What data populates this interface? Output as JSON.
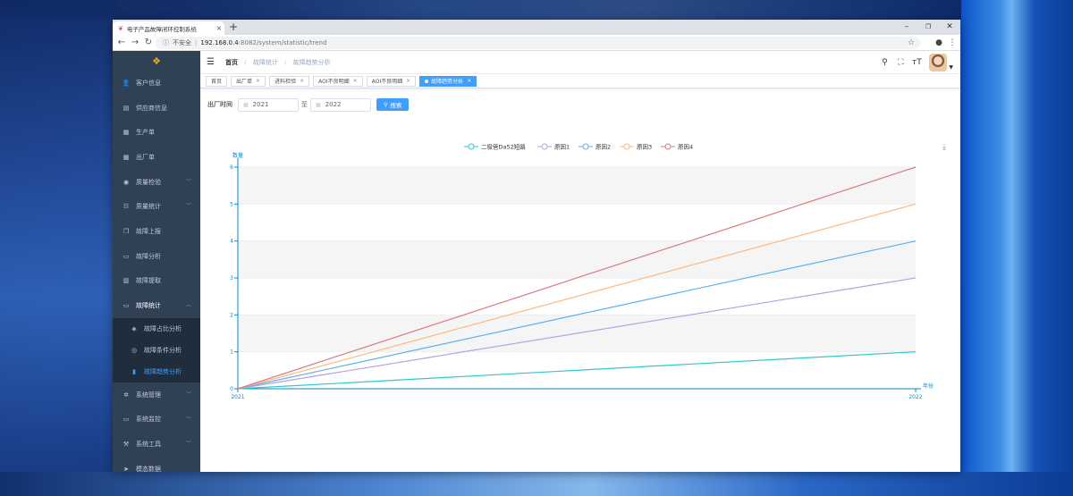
{
  "browser": {
    "tab_title": "电子产品故障闭环控制系统",
    "new_tab_symbol": "+",
    "security_label": "不安全",
    "url_host": "192.168.0.4",
    "url_path": ":8082/system/statistic/trend"
  },
  "sidebar": {
    "items": [
      {
        "label": "客户信息",
        "icon": "user-icon"
      },
      {
        "label": "供应商信息",
        "icon": "shop-icon"
      },
      {
        "label": "生产单",
        "icon": "document-icon"
      },
      {
        "label": "出厂单",
        "icon": "document-icon"
      },
      {
        "label": "质量检验",
        "icon": "eye-icon",
        "has_children": true
      },
      {
        "label": "质量统计",
        "icon": "list-icon",
        "has_children": true
      },
      {
        "label": "故障上报",
        "icon": "copy-icon"
      },
      {
        "label": "故障分析",
        "icon": "monitor-icon"
      },
      {
        "label": "故障提取",
        "icon": "table-icon"
      },
      {
        "label": "故障统计",
        "icon": "monitor-icon",
        "expanded": true
      }
    ],
    "sub_items": [
      {
        "label": "故障占比分析",
        "icon": "layers-icon"
      },
      {
        "label": "故障条件分析",
        "icon": "circle-icon"
      },
      {
        "label": "故障趋势分析",
        "icon": "bar-chart-icon",
        "current": true
      }
    ],
    "bottom_items": [
      {
        "label": "系统管理",
        "icon": "gear-icon",
        "has_children": true
      },
      {
        "label": "系统监控",
        "icon": "monitor-icon",
        "has_children": true
      },
      {
        "label": "系统工具",
        "icon": "tool-icon",
        "has_children": true
      },
      {
        "label": "模态数据",
        "icon": "send-icon"
      }
    ]
  },
  "breadcrumb": [
    "首页",
    "故障统计",
    "故障趋势分析"
  ],
  "tags": [
    {
      "label": "首页",
      "closable": false
    },
    {
      "label": "出厂单",
      "closable": true
    },
    {
      "label": "进料检验",
      "closable": true
    },
    {
      "label": "AOI不良明细",
      "closable": true
    },
    {
      "label": "AOI不良明细",
      "closable": true
    },
    {
      "label": "故障趋势分析",
      "closable": true,
      "active": true
    }
  ],
  "filter": {
    "label": "出厂时间",
    "start": "2021",
    "connector": "至",
    "end": "2022",
    "search_label": "搜索"
  },
  "chart_data": {
    "type": "line",
    "x": [
      "2021",
      "2022"
    ],
    "series": [
      {
        "name": "二极管Da52短路",
        "values": [
          0,
          1
        ],
        "color": "#2ec7c9"
      },
      {
        "name": "原因1",
        "values": [
          0,
          3
        ],
        "color": "#b6a2de"
      },
      {
        "name": "原因2",
        "values": [
          0,
          4
        ],
        "color": "#5ab1ef"
      },
      {
        "name": "原因3",
        "values": [
          0,
          5
        ],
        "color": "#ffb980"
      },
      {
        "name": "原因4",
        "values": [
          0,
          6
        ],
        "color": "#d87a80"
      }
    ],
    "ylabel": "数量",
    "xlabel": "年份",
    "ylim": [
      0,
      6
    ],
    "yticks": [
      "0",
      "1",
      "2",
      "3",
      "4",
      "5",
      "6"
    ],
    "grid": true,
    "legend_position": "top-center",
    "axis_color": "#008acd"
  }
}
